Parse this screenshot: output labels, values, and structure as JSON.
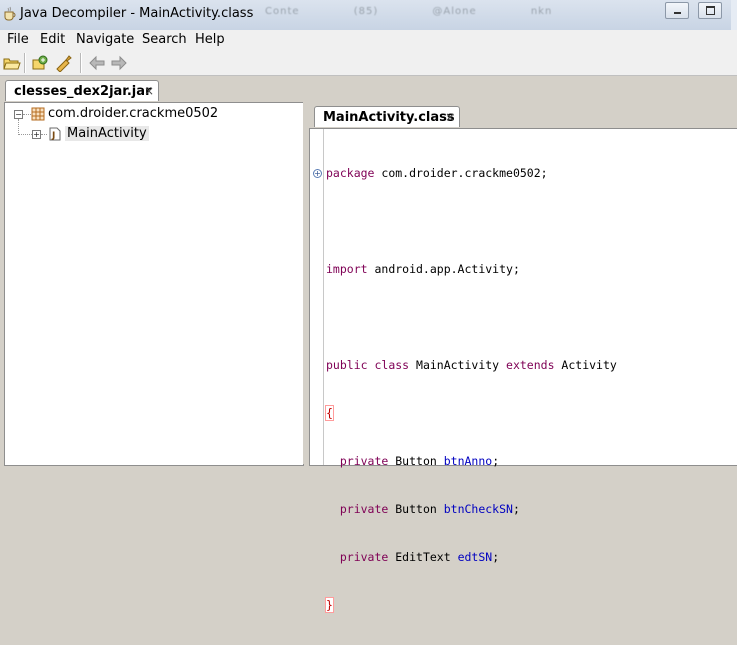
{
  "window": {
    "title": "Java Decompiler - MainActivity.class",
    "blurred_texts": [
      "Conte",
      "(85)",
      "@Alone",
      "nkn"
    ]
  },
  "menu": {
    "items": [
      "File",
      "Edit",
      "Navigate",
      "Search",
      "Help"
    ]
  },
  "toolbar": {
    "buttons": [
      "open-file-icon",
      "open-type-icon",
      "reference-icon",
      "back-arrow-icon",
      "forward-arrow-icon"
    ]
  },
  "left_tab": {
    "label": "clesses_dex2jar.jar",
    "close": "×"
  },
  "tree": {
    "package": "com.droider.crackme0502",
    "class": "MainActivity"
  },
  "editor_tab": {
    "label": "MainActivity.class",
    "close": "×"
  },
  "code": {
    "package_kw": "package",
    "package_name": " com.droider.crackme0502;",
    "import_kw": "import",
    "import_name": " android.app.Activity;",
    "public_kw": "public",
    "class_kw": " class",
    "class_name": " MainActivity ",
    "extends_kw": "extends",
    "super_name": " Activity",
    "open_brace": "{",
    "close_brace": "}",
    "fields": [
      {
        "mod": "private",
        "type": " Button ",
        "name": "btnAnno",
        "end": ";"
      },
      {
        "mod": "private",
        "type": " Button ",
        "name": "btnCheckSN",
        "end": ";"
      },
      {
        "mod": "private",
        "type": " EditText ",
        "name": "edtSN",
        "end": ";"
      }
    ],
    "fold_marker": "+"
  }
}
